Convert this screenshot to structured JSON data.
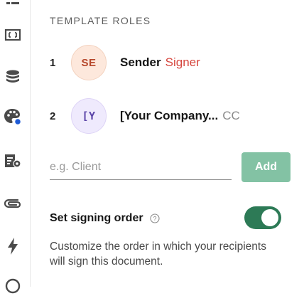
{
  "sidebar": {
    "icons": [
      "list-icon",
      "frame-icon",
      "database-icon",
      "palette-icon",
      "form-settings-icon",
      "paperclip-icon",
      "lightning-icon",
      "circle-icon"
    ]
  },
  "template_roles": {
    "title": "TEMPLATE ROLES",
    "roles": [
      {
        "number": "1",
        "initials": "SE",
        "name": "Sender",
        "type": "Signer"
      },
      {
        "number": "2",
        "initials": "[Y",
        "name": "[Your Company...",
        "type": "CC"
      }
    ],
    "input_placeholder": "e.g. Client",
    "add_label": "Add"
  },
  "signing_order": {
    "label": "Set signing order",
    "enabled": true,
    "description": "Customize the order in which your recipients will sign this document."
  },
  "colors": {
    "accent_green": "#2d7a56",
    "add_button": "#83c2a4",
    "signer_red": "#d6453d"
  }
}
